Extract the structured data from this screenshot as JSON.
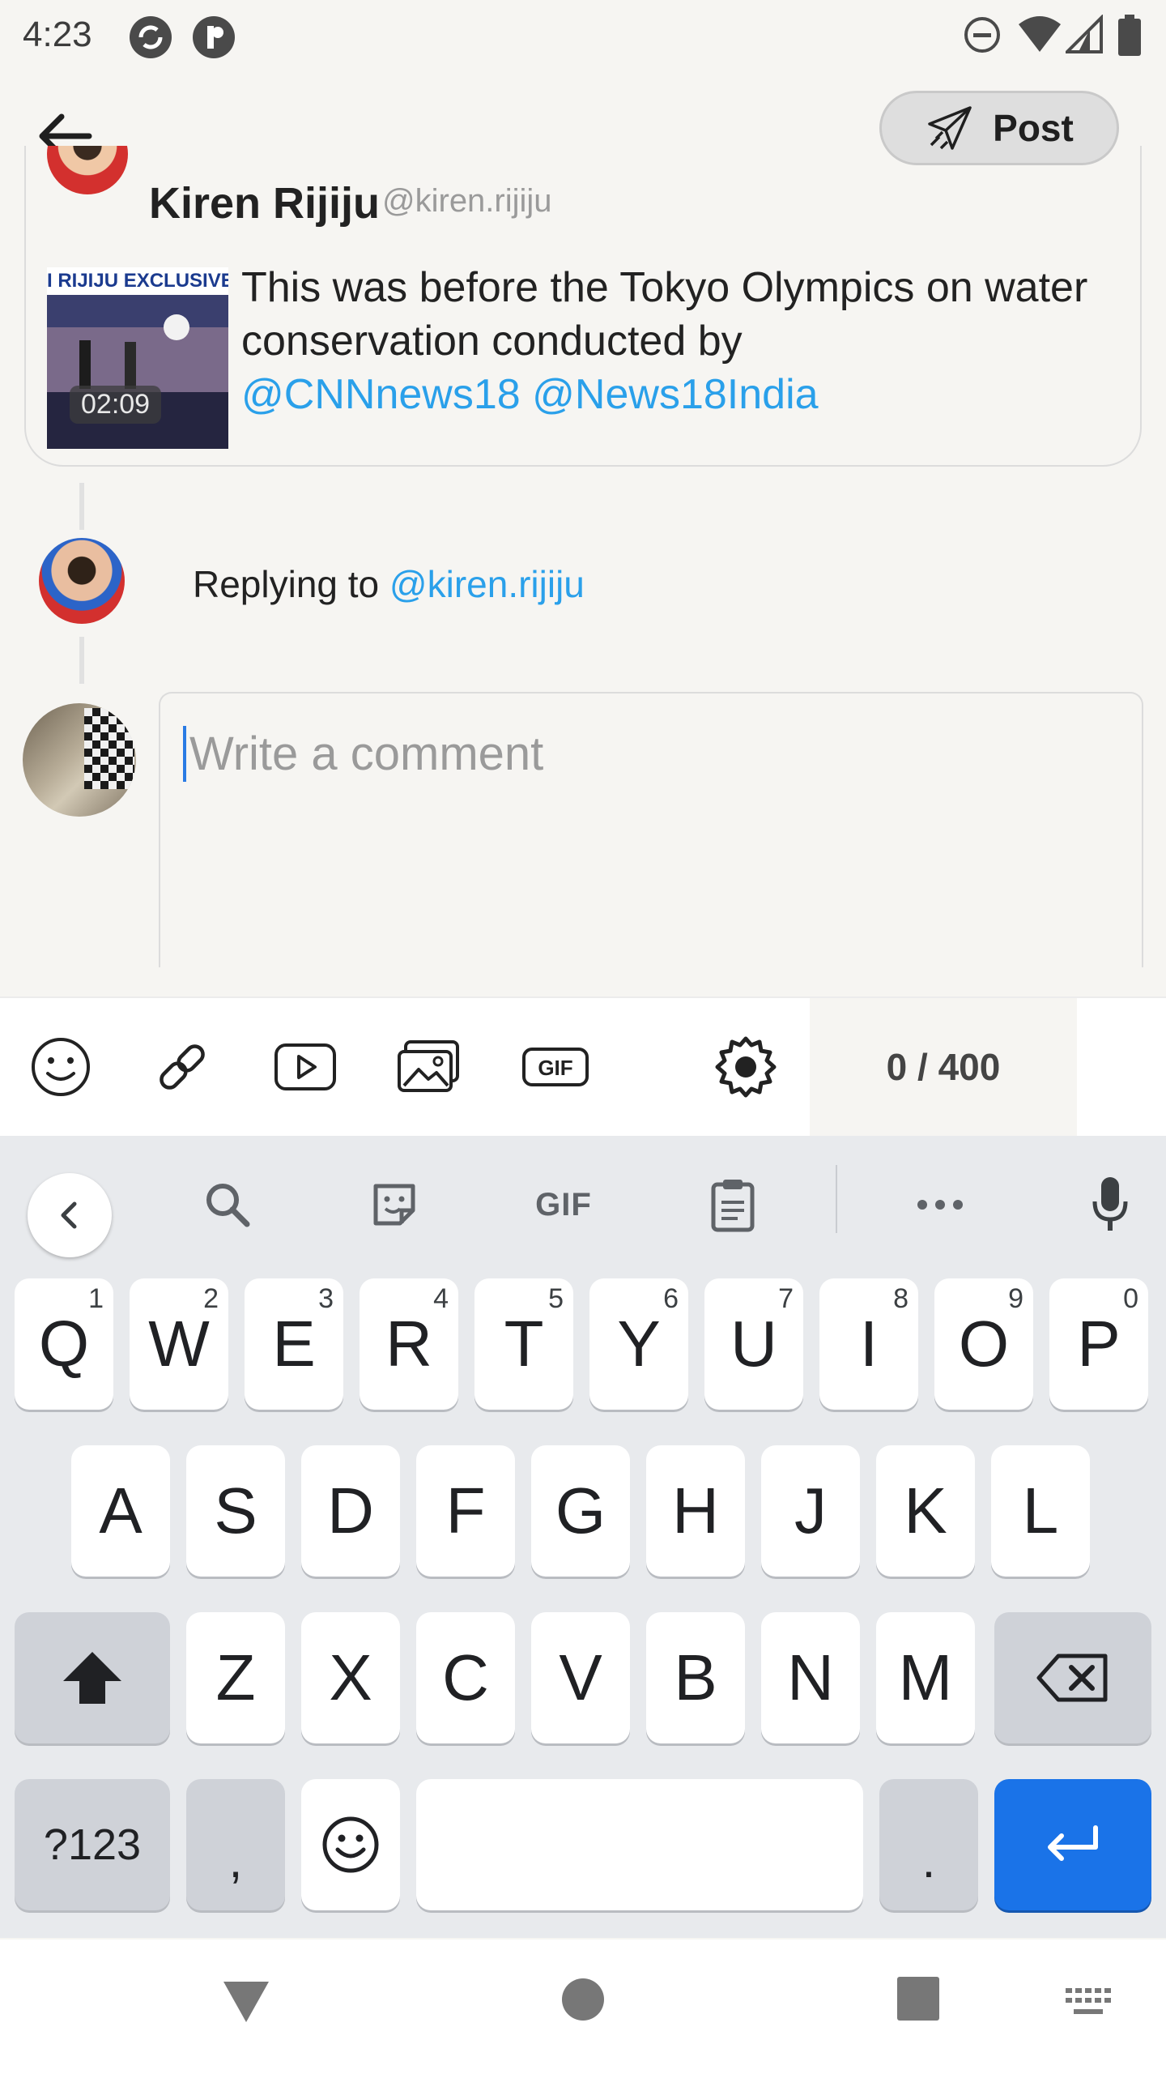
{
  "status_bar": {
    "time": "4:23"
  },
  "app_bar": {
    "post_label": "Post"
  },
  "quoted_post": {
    "author_name": "Kiren Rijiju",
    "author_handle": "@kiren.rijiju",
    "thumbnail_title": "I RIJIJU EXCLUSIVE",
    "video_duration": "02:09",
    "text": "This was before the Tokyo Olympics on water conservation conducted by",
    "mention_1": "@CNNnews18",
    "mention_2": "@News18India"
  },
  "reply": {
    "prefix": "Replying to",
    "handle": "@kiren.rijiju"
  },
  "comment": {
    "placeholder": "Write a comment",
    "value": ""
  },
  "toolbar": {
    "icons": [
      "emoji-icon",
      "link-icon",
      "youtube-icon",
      "image-icon",
      "gif-icon",
      "settings-icon"
    ],
    "gif_label": "GIF",
    "char_count": "0 / 400"
  },
  "keyboard": {
    "suggestion_gif_label": "GIF",
    "row1": [
      {
        "k": "Q",
        "h": "1"
      },
      {
        "k": "W",
        "h": "2"
      },
      {
        "k": "E",
        "h": "3"
      },
      {
        "k": "R",
        "h": "4"
      },
      {
        "k": "T",
        "h": "5"
      },
      {
        "k": "Y",
        "h": "6"
      },
      {
        "k": "U",
        "h": "7"
      },
      {
        "k": "I",
        "h": "8"
      },
      {
        "k": "O",
        "h": "9"
      },
      {
        "k": "P",
        "h": "0"
      }
    ],
    "row2": [
      "A",
      "S",
      "D",
      "F",
      "G",
      "H",
      "J",
      "K",
      "L"
    ],
    "row3": [
      "Z",
      "X",
      "C",
      "V",
      "B",
      "N",
      "M"
    ],
    "symbols_label": "?123",
    "comma": ",",
    "period": ".",
    "accent": "#1a73e8"
  }
}
